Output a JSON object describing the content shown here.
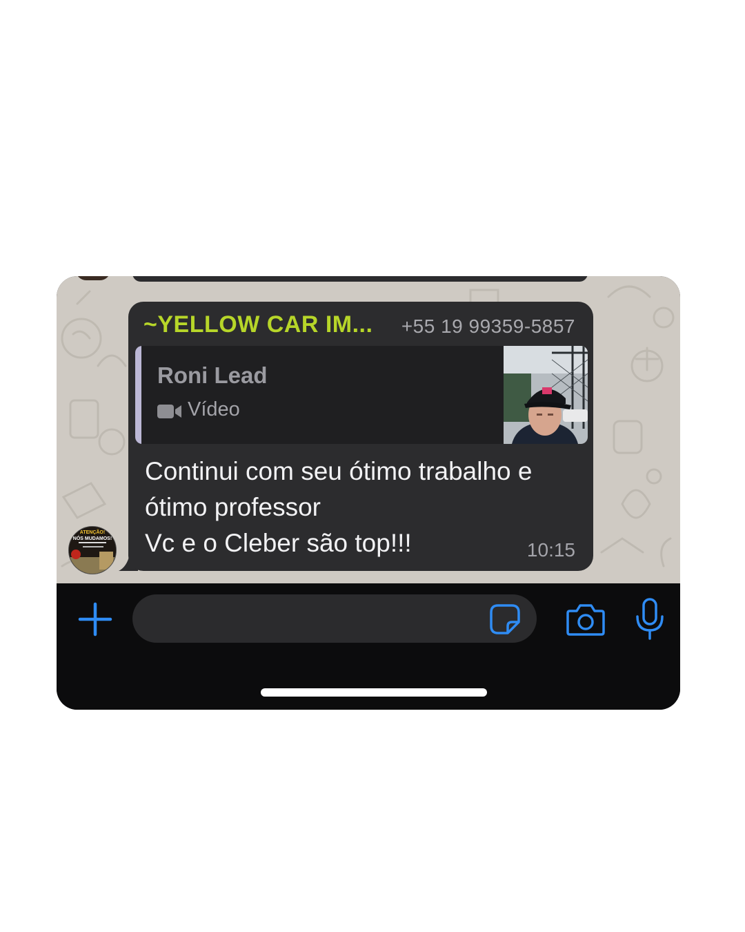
{
  "message": {
    "sender_name": "~YELLOW CAR IM...",
    "sender_phone": "+55 19 99359-5857",
    "quoted": {
      "author": "Roni Lead",
      "type_label": "Vídeo",
      "type_icon": "video-camera-icon"
    },
    "text_lines": [
      "Continui com seu ótimo trabalho e",
      "ótimo professor",
      "Vc e o Cleber são top!!!"
    ],
    "time": "10:15"
  },
  "avatar": {
    "headline": "ATENÇÃO!",
    "subline": "NÓS MUDAMOS!"
  },
  "colors": {
    "sender_name": "#b7d629",
    "bubble": "#2c2c2e",
    "accent_icons": "#2f8cf4",
    "chat_wallpaper": "#cfcac3"
  },
  "input_bar": {
    "icons": [
      "plus-icon",
      "sticker-icon",
      "camera-icon",
      "microphone-icon"
    ]
  }
}
